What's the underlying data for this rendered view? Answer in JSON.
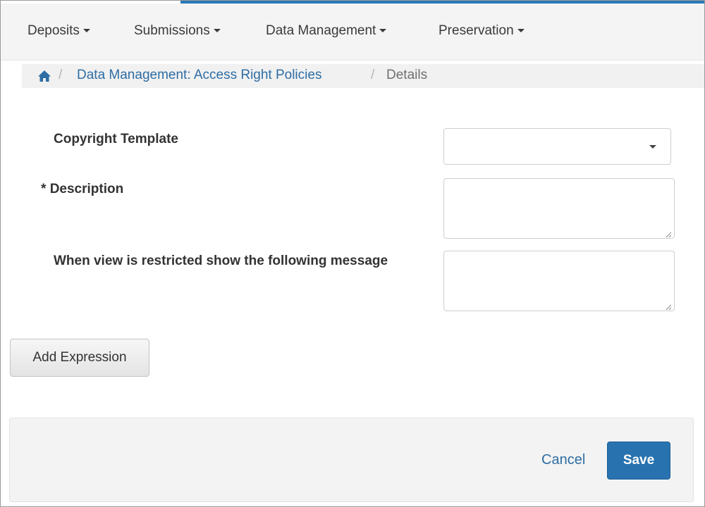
{
  "nav": {
    "items": [
      {
        "label": "Deposits"
      },
      {
        "label": "Submissions"
      },
      {
        "label": "Data Management"
      },
      {
        "label": "Preservation"
      }
    ]
  },
  "breadcrumb": {
    "home_icon": "home-icon",
    "separator": "/",
    "parent": "Data Management: Access Right Policies",
    "current": "Details"
  },
  "form": {
    "copyright_template": {
      "label": "Copyright Template",
      "value": ""
    },
    "description": {
      "required_marker": "*",
      "label": "Description",
      "value": ""
    },
    "restricted_message": {
      "label": "When view is restricted show the following message",
      "value": ""
    },
    "add_expression_label": "Add Expression"
  },
  "footer": {
    "cancel_label": "Cancel",
    "save_label": "Save"
  },
  "colors": {
    "accent": "#2b78b5",
    "link": "#2e6da4",
    "primary_button": "#2872b0"
  }
}
